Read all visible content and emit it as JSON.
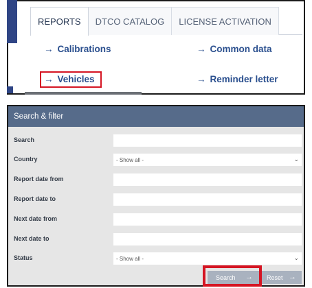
{
  "tabs": [
    {
      "label": "REPORTS",
      "active": true
    },
    {
      "label": "DTCO CATALOG",
      "active": false
    },
    {
      "label": "LICENSE ACTIVATION",
      "active": false
    }
  ],
  "links": {
    "calibrations": "Calibrations",
    "common_data": "Common data",
    "vehicles": "Vehicles",
    "reminder_letter": "Reminder letter",
    "arrow": "→"
  },
  "filter": {
    "header": "Search & filter",
    "fields": {
      "search": {
        "label": "Search",
        "value": ""
      },
      "country": {
        "label": "Country",
        "value": "- Show all -"
      },
      "report_date_from": {
        "label": "Report date from",
        "value": ""
      },
      "report_date_to": {
        "label": "Report date to",
        "value": ""
      },
      "next_date_from": {
        "label": "Next date from",
        "value": ""
      },
      "next_date_to": {
        "label": "Next date to",
        "value": ""
      },
      "status": {
        "label": "Status",
        "value": "- Show all -"
      }
    },
    "search_button": "Search",
    "reset_button": "Reset",
    "button_arrow": "→"
  },
  "colors": {
    "accent_blue": "#2f4585",
    "link_blue": "#2a4f8e",
    "header_bg": "#566b8a",
    "highlight_red": "#d51523",
    "panel_bg": "#e6e6e6"
  },
  "icons": {
    "select_chevron": "chevron-down-icon",
    "link_arrow": "arrow-right-icon"
  }
}
